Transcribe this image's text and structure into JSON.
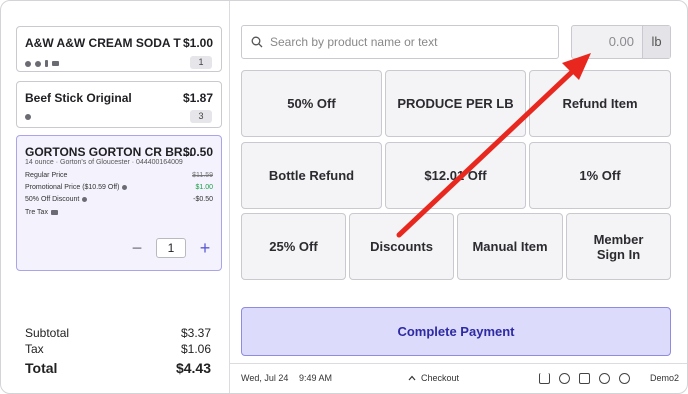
{
  "cart": {
    "items": [
      {
        "name": "A&W A&W CREAM SODA T",
        "price": "$1.00",
        "qty": "1"
      },
      {
        "name": "Beef Stick Original",
        "price": "$1.87",
        "qty": "3"
      },
      {
        "name": "GORTONS GORTON CR BR...",
        "price": "$0.50",
        "sub": "14 ounce · Gorton's of Gloucester · 044400164009",
        "lines": [
          {
            "label": "Regular Price",
            "value": "$11.59"
          },
          {
            "label": "Promotional Price ($10.59 Off)",
            "value": "$1.00"
          },
          {
            "label": "50% Off Discount",
            "value": "-$0.50"
          },
          {
            "label": "Tre Tax",
            "value": ""
          }
        ],
        "qty": "1"
      }
    ],
    "stepper": {
      "minus": "−",
      "plus": "+"
    }
  },
  "totals": {
    "subtotal_label": "Subtotal",
    "subtotal": "$3.37",
    "tax_label": "Tax",
    "tax": "$1.06",
    "total_label": "Total",
    "total": "$4.43"
  },
  "search": {
    "placeholder": "Search by product name or text"
  },
  "weight": {
    "value": "0.00",
    "unit": "lb"
  },
  "tiles": {
    "pct50": "50% Off",
    "produce": "PRODUCE PER LB",
    "refund": "Refund Item",
    "bottle": "Bottle Refund",
    "fixed": "$12.01 Off",
    "pct1": "1% Off",
    "pct25": "25% Off",
    "discounts": "Discounts",
    "manual": "Manual Item",
    "member_l1": "Member",
    "member_l2": "Sign In"
  },
  "complete_payment": "Complete Payment",
  "statusbar": {
    "date": "Wed, Jul 24",
    "time": "9:49 AM",
    "checkout": "Checkout",
    "user": "Demo2"
  },
  "colors": {
    "accent": "#5a5ad6",
    "annotation": "#e8281f",
    "promo_green": "#1a9e47"
  },
  "icons": [
    "search-icon",
    "cart-icon",
    "dollar-icon",
    "receipt-icon",
    "gear-icon",
    "user-icon",
    "chevron-up-icon"
  ]
}
